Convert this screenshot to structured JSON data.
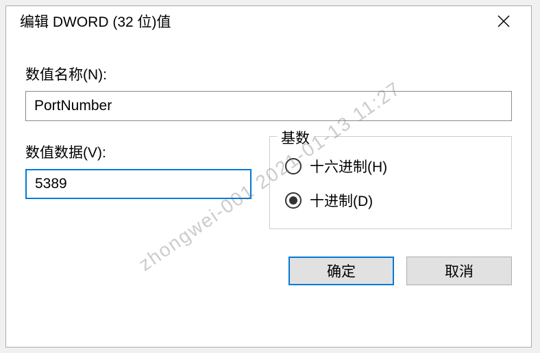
{
  "dialog": {
    "title": "编辑 DWORD (32 位)值",
    "name_label": "数值名称(N):",
    "name_value": "PortNumber",
    "value_label": "数值数据(V):",
    "value_value": "5389",
    "base_legend": "基数",
    "radio_hex": "十六进制(H)",
    "radio_dec": "十进制(D)",
    "ok_label": "确定",
    "cancel_label": "取消"
  },
  "watermark": "zhongwei-001   2021-01-13   11:27"
}
